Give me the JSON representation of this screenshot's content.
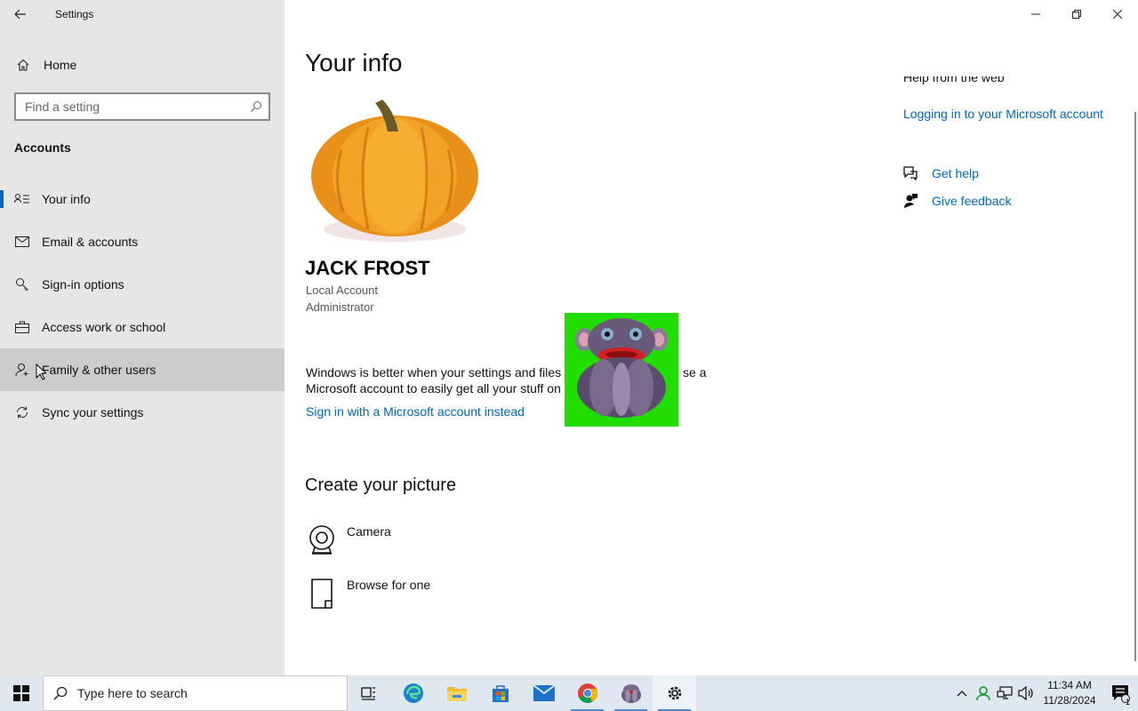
{
  "window": {
    "app_title": "Settings",
    "back_icon": "back-arrow-icon",
    "controls": [
      "minimize-icon",
      "restore-icon",
      "close-icon"
    ]
  },
  "sidebar": {
    "home_label": "Home",
    "search_placeholder": "Find a setting",
    "section": "Accounts",
    "items": [
      {
        "label": "Your info",
        "icon": "person-card-icon",
        "selected": true
      },
      {
        "label": "Email & accounts",
        "icon": "mail-icon"
      },
      {
        "label": "Sign-in options",
        "icon": "key-icon"
      },
      {
        "label": "Access work or school",
        "icon": "briefcase-icon"
      },
      {
        "label": "Family & other users",
        "icon": "person-add-icon",
        "hovered": true
      },
      {
        "label": "Sync your settings",
        "icon": "sync-icon"
      }
    ]
  },
  "main": {
    "title": "Your info",
    "user_name": "JACK FROST",
    "account_type": "Local Account",
    "account_role": "Administrator",
    "info_text_part1": "Windows is better when your settings and files",
    "info_text_part1b": "se a",
    "info_text_part2": "Microsoft account to easily get all your stuff on",
    "signin_link": "Sign in with a Microsoft account instead",
    "create_title": "Create your picture",
    "picture_options": [
      {
        "label": "Camera",
        "icon": "camera-icon"
      },
      {
        "label": "Browse for one",
        "icon": "browse-file-icon"
      }
    ]
  },
  "help": {
    "header": "Help from the web",
    "links": [
      "Logging in to your Microsoft account"
    ],
    "actions": [
      {
        "label": "Get help",
        "icon": "get-help-icon"
      },
      {
        "label": "Give feedback",
        "icon": "feedback-icon"
      }
    ]
  },
  "taskbar": {
    "search_text": "Type here to search",
    "apps": [
      "task-view-icon",
      "edge-icon",
      "file-explorer-icon",
      "store-icon",
      "mail-icon",
      "chrome-icon",
      "bonzi-icon",
      "settings-icon"
    ],
    "time": "11:34 AM",
    "date": "11/28/2024",
    "notification_count": "1"
  },
  "colors": {
    "accent": "#0067c0",
    "sidebar_bg": "#e6e6e6",
    "taskbar_bg": "#dfe8f0",
    "sticker_bg": "#22dd00"
  }
}
